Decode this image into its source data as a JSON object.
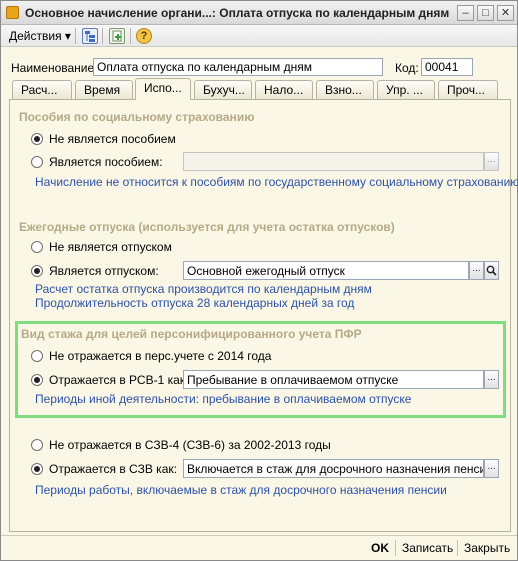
{
  "window": {
    "title": "Основное начисление органи...: Оплата отпуска по календарным дням",
    "minimize_glyph": "–",
    "maximize_glyph": "□",
    "close_glyph": "✕"
  },
  "toolbar": {
    "actions_label": "Действия",
    "actions_arrow": "▾",
    "help_glyph": "?"
  },
  "header": {
    "name_label": "Наименование:",
    "name_value": "Оплата отпуска по календарным дням",
    "code_label": "Код:",
    "code_value": "00041"
  },
  "tabs": [
    {
      "label": "Расч..."
    },
    {
      "label": "Время"
    },
    {
      "label": "Испо..."
    },
    {
      "label": "Бухуч..."
    },
    {
      "label": "Нало..."
    },
    {
      "label": "Взно..."
    },
    {
      "label": "Упр. ..."
    },
    {
      "label": "Проч..."
    }
  ],
  "social": {
    "title": "Пособия по социальному страхованию",
    "option_not": "Не является пособием",
    "option_is": "Является пособием:",
    "field_value": "",
    "note": "Начисление не относится к пособиям по государственному социальному страхованию"
  },
  "vacation": {
    "title": "Ежегодные отпуска (используется для учета остатка отпусков)",
    "option_not": "Не является отпуском",
    "option_is": "Является отпуском:",
    "field_value": "Основной ежегодный отпуск",
    "note1": "Расчет остатка отпуска производится по календарным дням",
    "note2": "Продолжительность отпуска 28 календарных дней за год"
  },
  "pfr": {
    "title": "Вид стажа для целей персонифицированного учета ПФР",
    "option_not": "Не отражается в перс.учете с 2014 года",
    "option_is": "Отражается в РСВ-1 как:",
    "field_value": "Пребывание в оплачиваемом отпуске",
    "note": "Периоды иной деятельности: пребывание в оплачиваемом отпуске"
  },
  "szv": {
    "option_not": "Не отражается в СЗВ-4 (СЗВ-6) за 2002-2013 годы",
    "option_is": "Отражается в СЗВ как:",
    "field_value": "Включается в стаж для досрочного назначения пенсии",
    "note": "Периоды работы, включаемые в стаж для досрочного назначения пенсии"
  },
  "footer": {
    "ok_label": "OK",
    "save_label": "Записать",
    "close_label": "Закрыть"
  },
  "icons": {
    "dots": "...",
    "search": "🔍"
  },
  "colors": {
    "panel_bg": "#fbf7e6",
    "section_title": "#b5aa85",
    "note_text": "#2c51a8",
    "highlight_border": "#7fdc7f"
  }
}
